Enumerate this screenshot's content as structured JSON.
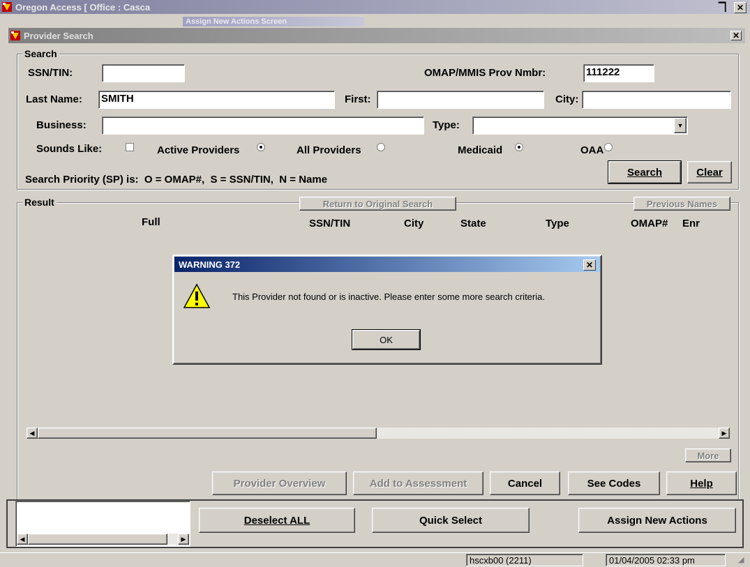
{
  "outer_window": {
    "title": "Oregon Access [ Office : Casca",
    "overlap_title": "Assign New Actions Screen"
  },
  "dialog": {
    "title": "Provider Search",
    "search_legend": "Search",
    "ssn_label": "SSN/TIN:",
    "ssn_value": "",
    "omap_label": "OMAP/MMIS Prov Nmbr:",
    "omap_value": "111222",
    "last_name_label": "Last Name:",
    "last_name_value": "SMITH",
    "first_label": "First:",
    "first_value": "",
    "city_label": "City:",
    "city_value": "",
    "business_label": "Business:",
    "business_value": "",
    "type_label": "Type:",
    "type_value": "",
    "sounds_like_label": "Sounds Like:",
    "active_providers_label": "Active Providers",
    "all_providers_label": "All Providers",
    "medicaid_label": "Medicaid",
    "oaa_label": "OAA",
    "priority_text": "Search Priority (SP) is:  O = OMAP#,  S = SSN/TIN,  N = Name",
    "search_button": "Search",
    "clear_button": "Clear",
    "result_legend": "Result",
    "return_button": "Return to Original Search",
    "previous_names_button": "Previous Names",
    "columns": {
      "full": "Full",
      "ssn": "SSN/TIN",
      "city": "City",
      "state": "State",
      "type": "Type",
      "omap": "OMAP#",
      "enr": "Enr"
    },
    "more_button": "More",
    "provider_overview_button": "Provider Overview",
    "add_to_assessment_button": "Add to Assessment",
    "cancel_button": "Cancel",
    "see_codes_button": "See Codes",
    "help_button": "Help"
  },
  "warning": {
    "title": "WARNING 372",
    "message": "This Provider not found or is inactive. Please enter some more search criteria.",
    "ok_button": "OK"
  },
  "bottom_bar": {
    "deselect_all": "Deselect ALL",
    "quick_select": "Quick Select",
    "assign_new_actions": "Assign New Actions"
  },
  "status_bar": {
    "user": "hscxb00 (2211)",
    "datetime": "01/04/2005 02:33 pm"
  },
  "colors": {
    "active_title": "#0a246a",
    "face": "#d4d0c8",
    "warning_icon": "#ffff00"
  },
  "icons": [
    "app-icon",
    "close-icon",
    "warning-icon",
    "dropdown-arrow-icon",
    "scroll-left-icon",
    "scroll-right-icon"
  ]
}
